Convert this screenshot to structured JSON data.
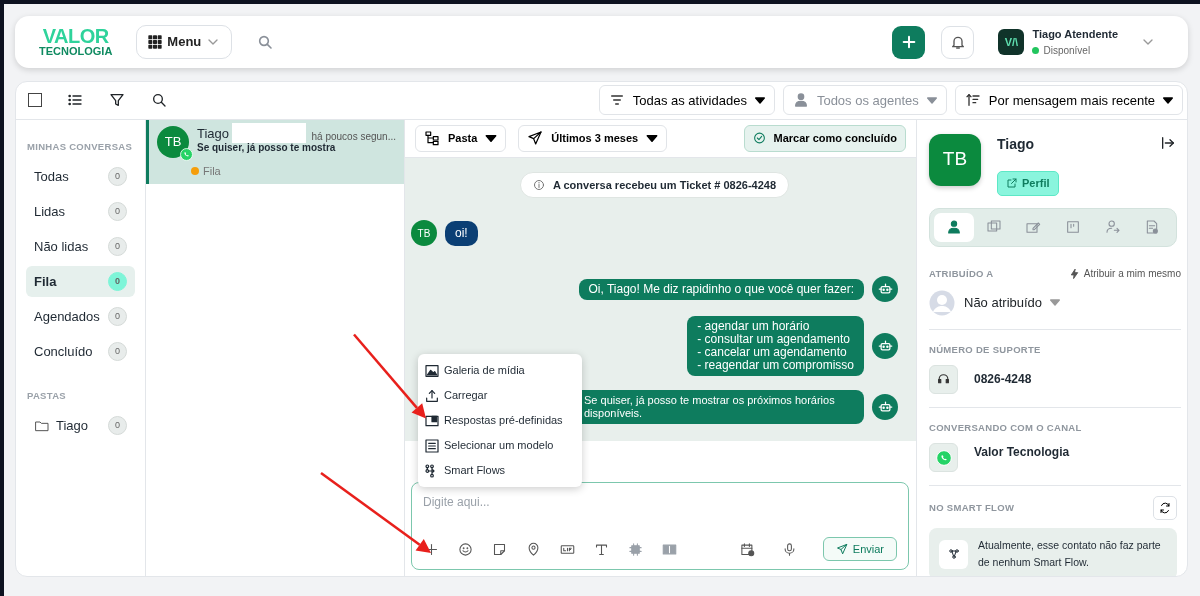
{
  "header": {
    "logo": {
      "line1": "VALOR",
      "line2": "TECNOLOGIA"
    },
    "menu_button": "Menu",
    "user": {
      "initials": "V/\\",
      "name": "Tiago Atendente",
      "status": "Disponível",
      "online": true
    }
  },
  "toolbar": {
    "select_all": {
      "checked": false
    },
    "filters": [
      {
        "label": "Todas as atividades",
        "kind": "lines",
        "disabled": false
      },
      {
        "label": "Todos os agentes",
        "kind": "person",
        "disabled": true
      },
      {
        "label": "Por mensagem mais recente",
        "kind": "sort",
        "disabled": false
      }
    ]
  },
  "sidebar": {
    "sections": [
      {
        "title": "MINHAS CONVERSAS",
        "items": [
          {
            "label": "Todas",
            "count": "0",
            "selected": false,
            "kind": "view"
          },
          {
            "label": "Lidas",
            "count": "0",
            "selected": false,
            "kind": "view"
          },
          {
            "label": "Não lidas",
            "count": "0",
            "selected": false,
            "kind": "view"
          },
          {
            "label": "Fila",
            "count": "0",
            "selected": true,
            "kind": "view"
          },
          {
            "label": "Agendados",
            "count": "0",
            "selected": false,
            "kind": "view"
          },
          {
            "label": "Concluído",
            "count": "0",
            "selected": false,
            "kind": "view"
          }
        ]
      },
      {
        "title": "PASTAS",
        "items": [
          {
            "label": "Tiago",
            "count": "0",
            "selected": false,
            "kind": "folder"
          }
        ]
      }
    ]
  },
  "conversations": [
    {
      "initials": "TB",
      "name": "Tiago",
      "preview": "Se quiser, já posso te mostra",
      "time": "há poucos segun...",
      "status": "Fila",
      "color": "#f59e0b",
      "selected": true
    }
  ],
  "chat": {
    "folder_button": "Pasta",
    "period_button": "Últimos 3 meses",
    "complete_button": "Marcar como concluído",
    "notice": "A conversa recebeu um Ticket # 0826-4248",
    "messages": [
      {
        "kind": "incoming",
        "initials": "TB",
        "text": "oi!"
      },
      {
        "kind": "bot",
        "text": "Oi, Tiago! Me diz rapidinho o que você quer fazer:"
      },
      {
        "kind": "bot",
        "text": "- agendar um horário\n- consultar um agendamento\n- cancelar um agendamento\n- reagendar um compromisso"
      },
      {
        "kind": "bot",
        "text": "Se quiser, já posso te mostrar os próximos horários\ndisponíveis."
      }
    ],
    "attach_menu": {
      "items": [
        {
          "label": "Galeria de mídia",
          "kind": "image"
        },
        {
          "label": "Carregar",
          "kind": "upload"
        },
        {
          "label": "Respostas pré-definidas",
          "kind": "card"
        },
        {
          "label": "Selecionar um modelo",
          "kind": "table"
        },
        {
          "label": "Smart Flows",
          "kind": "flow"
        }
      ]
    },
    "composer": {
      "placeholder": "Digite aqui...",
      "send_label": "Enviar"
    }
  },
  "annotations": [
    {
      "kind": "arrow"
    },
    {
      "kind": "arrow"
    }
  ],
  "contact_panel": {
    "initials": "TB",
    "name": "Tiago",
    "profile_button": "Perfil",
    "tabs": [
      {
        "kind": "person",
        "selected": true
      },
      {
        "kind": "cards",
        "selected": false
      },
      {
        "kind": "edit",
        "selected": false
      },
      {
        "kind": "window",
        "selected": false
      },
      {
        "kind": "transfer",
        "selected": false
      },
      {
        "kind": "doc",
        "selected": false
      }
    ],
    "assigned": {
      "title": "ATRIBUÍDO A",
      "action": "Atribuir a mim mesmo",
      "value": "Não atribuído"
    },
    "support": {
      "title": "NÚMERO DE SUPORTE",
      "number": "0826-4248"
    },
    "channel": {
      "title": "CONVERSANDO COM O CANAL",
      "name": "Valor Tecnologia"
    },
    "smart_flow": {
      "title": "NO SMART FLOW",
      "text": "Atualmente, esse contato não faz parte de nenhum Smart Flow."
    }
  }
}
